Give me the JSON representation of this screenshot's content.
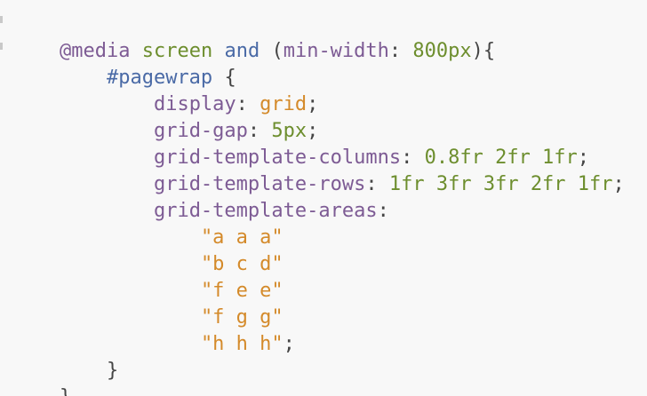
{
  "code": {
    "line1": {
      "at_rule": "@media",
      "media_type": "screen",
      "and": "and",
      "open_paren": "(",
      "feature": "min-width",
      "colon": ":",
      "value": "800px",
      "close": "){"
    },
    "line2": {
      "selector": "#pagewrap",
      "brace": "{"
    },
    "line3": {
      "prop": "display",
      "colon": ":",
      "value": "grid",
      "semi": ";"
    },
    "line4": {
      "prop": "grid-gap",
      "colon": ":",
      "value": "5px",
      "semi": ";"
    },
    "line5": {
      "prop": "grid-template-columns",
      "colon": ":",
      "value": "0.8fr 2fr 1fr",
      "semi": ";"
    },
    "line6": {
      "prop": "grid-template-rows",
      "colon": ":",
      "value": "1fr 3fr 3fr 2fr 1fr",
      "semi": ";"
    },
    "line7": {
      "prop": "grid-template-areas",
      "colon": ":"
    },
    "line8": {
      "value": "\"a a a\""
    },
    "line9": {
      "value": "\"b c d\""
    },
    "line10": {
      "value": "\"f e e\""
    },
    "line11": {
      "value": "\"f g g\""
    },
    "line12": {
      "value": "\"h h h\"",
      "semi": ";"
    },
    "line13": {
      "brace": "}"
    },
    "line14": {
      "brace": "}"
    }
  },
  "colors": {
    "background": "#f8f8f8",
    "keyword": "#7d5b94",
    "selector": "#4a6aa6",
    "string": "#d48a2a",
    "number": "#6d8e2e",
    "punctuation": "#454545"
  }
}
